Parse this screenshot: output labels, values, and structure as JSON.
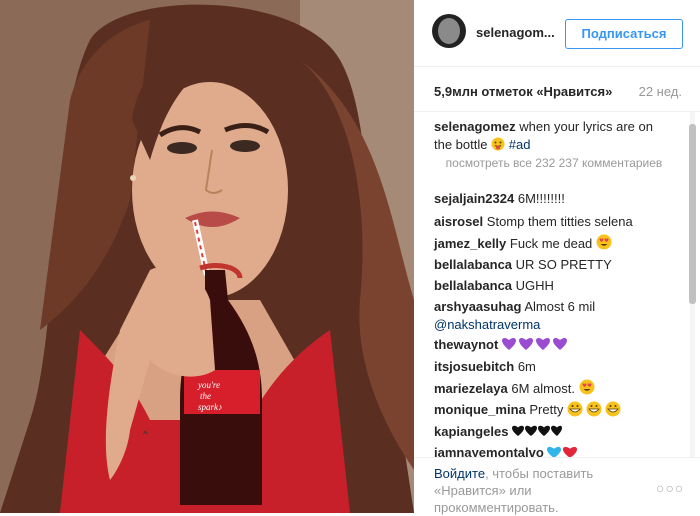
{
  "header": {
    "username": "selenagom...",
    "follow_label": "Подписаться"
  },
  "post": {
    "likes": "5,9млн отметок «Нравится»",
    "age": "22 нед."
  },
  "caption": {
    "user": "selenagomez",
    "text": "when your lyrics are on the bottle",
    "hashtag": "#ad"
  },
  "load_more": "посмотреть все 232 237 комментариев",
  "comments": [
    {
      "user": "sejaljain2324",
      "text": "6M!!!!!!!!"
    },
    {
      "user": "aisrosel",
      "text": "Stomp them titties selena"
    },
    {
      "user": "jamez_kelly",
      "text": "Fuck me dead"
    },
    {
      "user": "bellalabanca",
      "text": "UR SO PRETTY"
    },
    {
      "user": "bellalabanca",
      "text": "UGHH"
    },
    {
      "user": "arshyaasuhag",
      "text": "Almost 6 mil",
      "mention": "@nakshatraverma"
    },
    {
      "user": "thewaynot",
      "text": ""
    },
    {
      "user": "itsjosuebitch",
      "text": "6m"
    },
    {
      "user": "mariezelaya",
      "text": "6M almost."
    },
    {
      "user": "monique_mina",
      "text": "Pretty"
    },
    {
      "user": "kapiangeles",
      "text": ""
    },
    {
      "user": "iamnayemontalvo",
      "text": ""
    }
  ],
  "footer": {
    "login_link": "Войдите",
    "login_text": ", чтобы поставить «Нравится» или прокомментировать.",
    "more": "○○○"
  },
  "bottle_label": "you're the spark",
  "colors": {
    "accent": "#3897f0",
    "link": "#003569",
    "muted": "#999999",
    "coke_red": "#d61f2b"
  }
}
